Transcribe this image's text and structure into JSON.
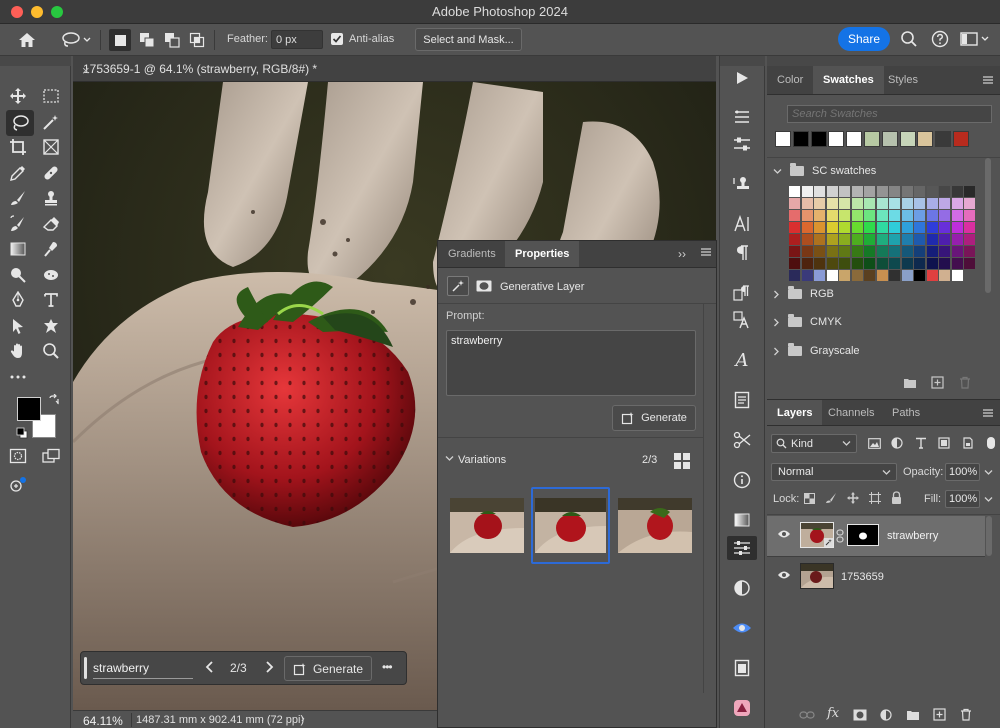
{
  "app": {
    "title": "Adobe Photoshop 2024"
  },
  "options_bar": {
    "feather_label": "Feather:",
    "feather_value": "0 px",
    "antialias_label": "Anti-alias",
    "antialias_checked": true,
    "select_mask_label": "Select and Mask...",
    "share_label": "Share"
  },
  "document": {
    "tab_title": "1753659-1 @ 64.1% (strawberry, RGB/8#) *",
    "zoom": "64.11%",
    "dimensions": "1487.31 mm x 902.41 mm (72 ppi)"
  },
  "context_bar": {
    "prompt": "strawberry",
    "counter": "2/3",
    "generate_label": "Generate",
    "more": "•••"
  },
  "properties_panel": {
    "tabs": [
      {
        "label": "Gradients",
        "active": false
      },
      {
        "label": "Properties",
        "active": true
      }
    ],
    "layer_type": "Generative Layer",
    "prompt_label": "Prompt:",
    "prompt_value": "strawberry",
    "generate_label": "Generate",
    "variations_label": "Variations",
    "variations_counter": "2/3",
    "selected_variation": 2
  },
  "swatches_panel": {
    "tabs": [
      {
        "label": "Color",
        "active": false
      },
      {
        "label": "Swatches",
        "active": true
      },
      {
        "label": "Styles",
        "active": false
      }
    ],
    "search_placeholder": "Search Swatches",
    "recent": [
      "#ffffff",
      "#000000",
      "#000000",
      "#ffffff",
      "#ffffff",
      "#b7c9a3",
      "#b6c1ad",
      "#c7d5b9",
      "#d9c49b",
      "#3a3a3a",
      "#b82b1e"
    ],
    "group_open": "SC swatches",
    "groups": [
      "RGB",
      "CMYK",
      "Grayscale"
    ]
  },
  "layers_panel": {
    "tabs": [
      {
        "label": "Layers",
        "active": true
      },
      {
        "label": "Channels",
        "active": false
      },
      {
        "label": "Paths",
        "active": false
      }
    ],
    "filter_kind": "Kind",
    "blend_mode": "Normal",
    "opacity_label": "Opacity:",
    "opacity_value": "100%",
    "lock_label": "Lock:",
    "fill_label": "Fill:",
    "fill_value": "100%",
    "layers": [
      {
        "name": "strawberry",
        "selected": true,
        "has_mask": true
      },
      {
        "name": "1753659",
        "selected": false,
        "has_mask": false
      }
    ]
  },
  "colors": {
    "accent": "#1473e6",
    "selection_border": "#2d6ad6",
    "panel_bg": "#535353",
    "tab_bg": "#424242"
  }
}
